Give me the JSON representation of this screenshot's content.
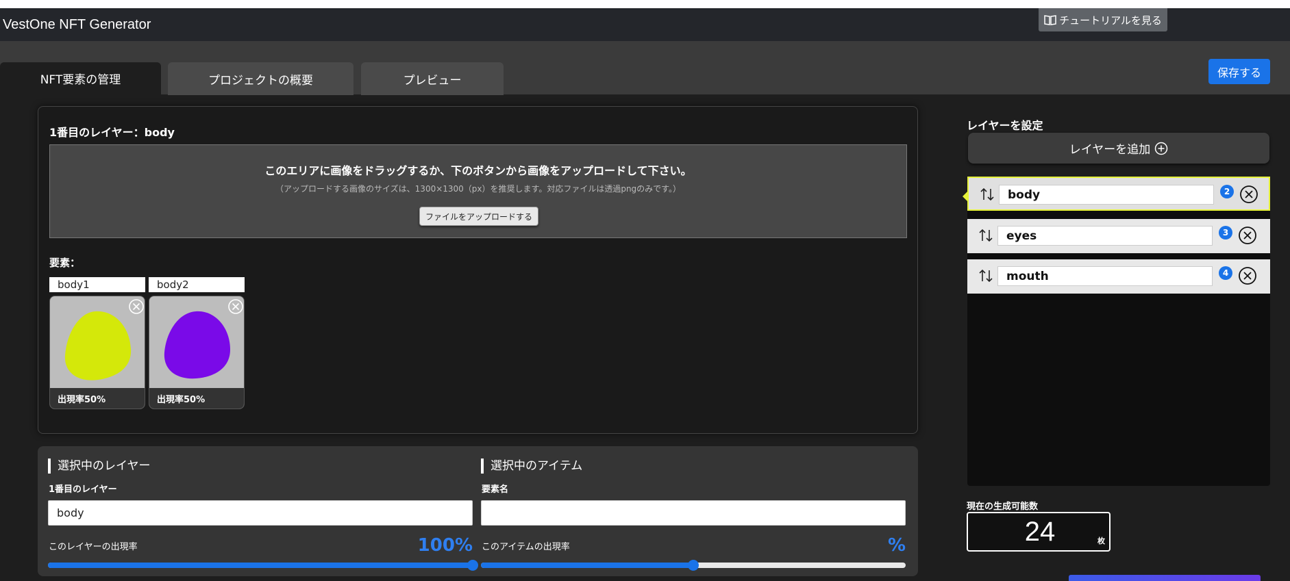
{
  "app": {
    "title": "VestOne NFT Generator"
  },
  "header": {
    "tutorial_label": "チュートリアルを見る"
  },
  "tabs": [
    {
      "label": "NFT要素の管理",
      "active": true
    },
    {
      "label": "プロジェクトの概要",
      "active": false
    },
    {
      "label": "プレビュー",
      "active": false
    }
  ],
  "toolbar": {
    "save_label": "保存する"
  },
  "layer_panel": {
    "heading": "1番目のレイヤー：body",
    "dropzone": {
      "title": "このエリアに画像をドラッグするか、下のボタンから画像をアップロードして下さい。",
      "subtitle": "（アップロードする画像のサイズは、1300×1300（px）を推奨します。対応ファイルは透過pngのみです。）",
      "upload_label": "ファイルをアップロードする"
    },
    "elements_label": "要素：",
    "elements": [
      {
        "name": "body1",
        "rate": "出現率50%",
        "color": "#d4e80a"
      },
      {
        "name": "body2",
        "rate": "出現率50%",
        "color": "#7a0ae8"
      }
    ]
  },
  "settings": {
    "layer_section_title": "選択中のレイヤー",
    "layer_field_label": "1番目のレイヤー",
    "layer_field_value": "body",
    "layer_rate_label": "このレイヤーの出現率",
    "layer_rate_value": "100%",
    "layer_rate_fraction": 1.0,
    "item_section_title": "選択中のアイテム",
    "item_field_label": "要素名",
    "item_field_value": "",
    "item_rate_label": "このアイテムの出現率",
    "item_rate_value": "%",
    "item_rate_fraction": 0.5
  },
  "right_panel": {
    "title": "レイヤーを設定",
    "add_layer_label": "レイヤーを追加",
    "layers": [
      {
        "name": "body",
        "badge": "2",
        "selected": true
      },
      {
        "name": "eyes",
        "badge": "3",
        "selected": false
      },
      {
        "name": "mouth",
        "badge": "4",
        "selected": false
      }
    ],
    "count_label": "現在の生成可能数",
    "count_value": "24",
    "count_unit": "枚"
  },
  "colors": {
    "accent": "#1a73e8",
    "selected_outline": "#e6f23a"
  }
}
